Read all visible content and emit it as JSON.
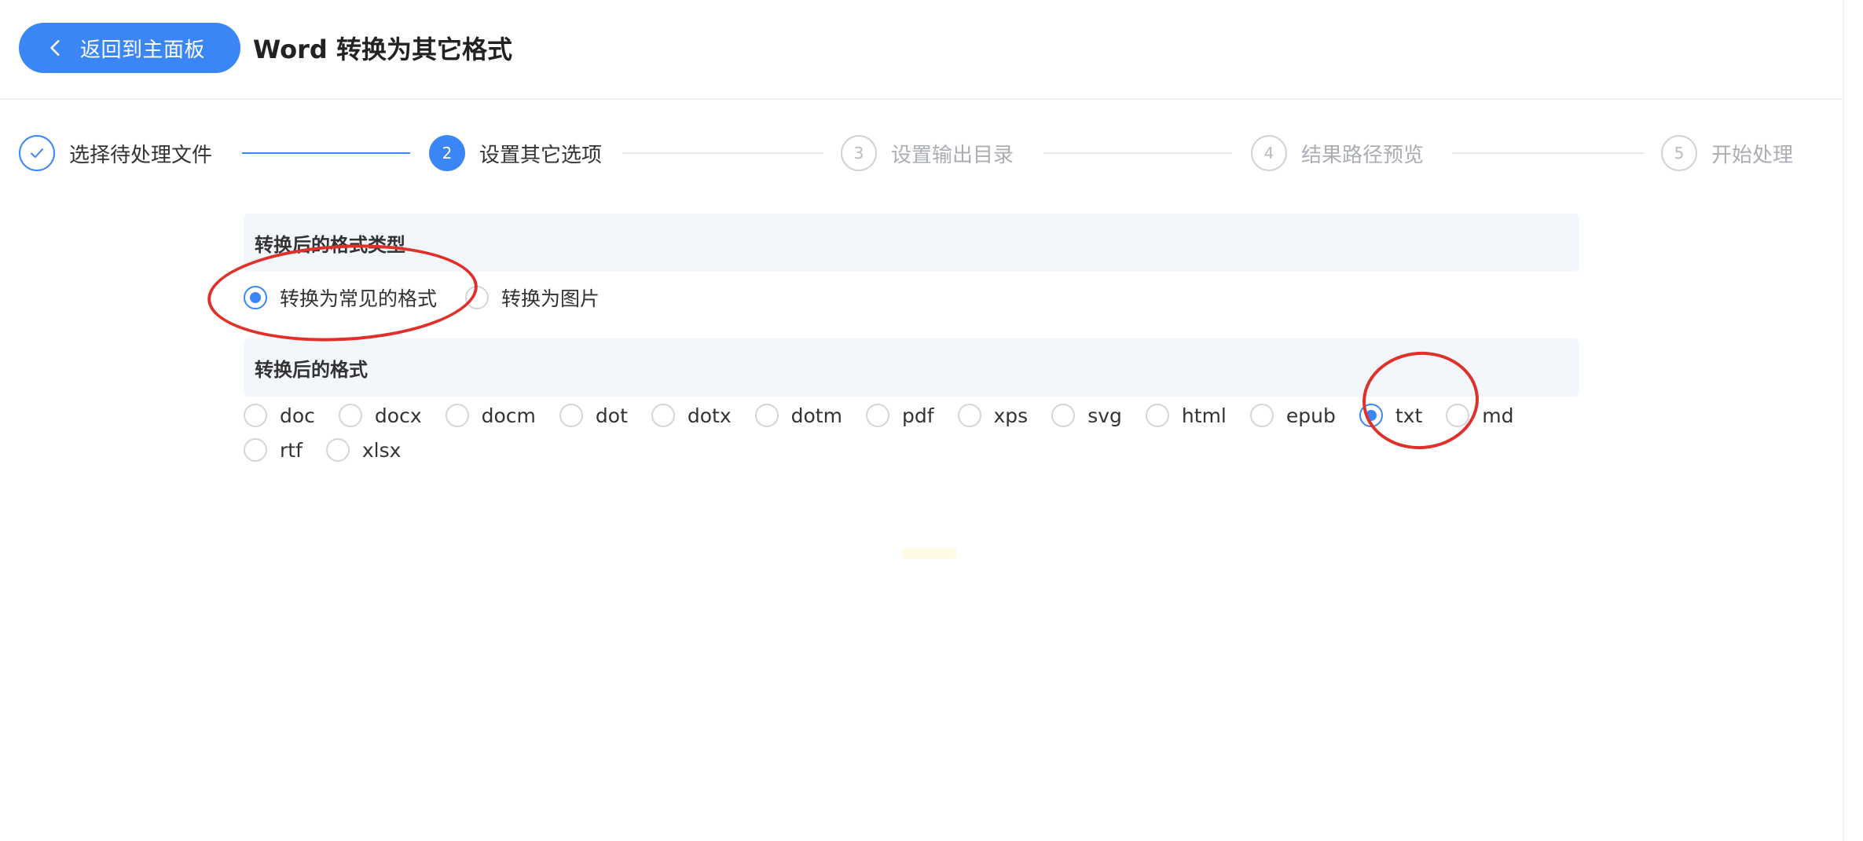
{
  "header": {
    "back_label": "返回到主面板",
    "title": "Word 转换为其它格式"
  },
  "steps": [
    {
      "number": "1",
      "label": "选择待处理文件",
      "state": "done",
      "icon": "check-icon"
    },
    {
      "number": "2",
      "label": "设置其它选项",
      "state": "active"
    },
    {
      "number": "3",
      "label": "设置输出目录",
      "state": "todo"
    },
    {
      "number": "4",
      "label": "结果路径预览",
      "state": "todo"
    },
    {
      "number": "5",
      "label": "开始处理",
      "state": "todo"
    }
  ],
  "format_type": {
    "heading": "转换后的格式类型",
    "options": [
      {
        "label": "转换为常见的格式",
        "checked": true
      },
      {
        "label": "转换为图片",
        "checked": false
      }
    ]
  },
  "format": {
    "heading": "转换后的格式",
    "options": [
      {
        "label": "doc",
        "checked": false
      },
      {
        "label": "docx",
        "checked": false
      },
      {
        "label": "docm",
        "checked": false
      },
      {
        "label": "dot",
        "checked": false
      },
      {
        "label": "dotx",
        "checked": false
      },
      {
        "label": "dotm",
        "checked": false
      },
      {
        "label": "pdf",
        "checked": false
      },
      {
        "label": "xps",
        "checked": false
      },
      {
        "label": "svg",
        "checked": false
      },
      {
        "label": "html",
        "checked": false
      },
      {
        "label": "epub",
        "checked": false
      },
      {
        "label": "txt",
        "checked": true
      },
      {
        "label": "md",
        "checked": false
      },
      {
        "label": "rtf",
        "checked": false
      },
      {
        "label": "xlsx",
        "checked": false
      }
    ]
  },
  "colors": {
    "accent": "#3b86f6",
    "annotation": "#e0302a"
  }
}
